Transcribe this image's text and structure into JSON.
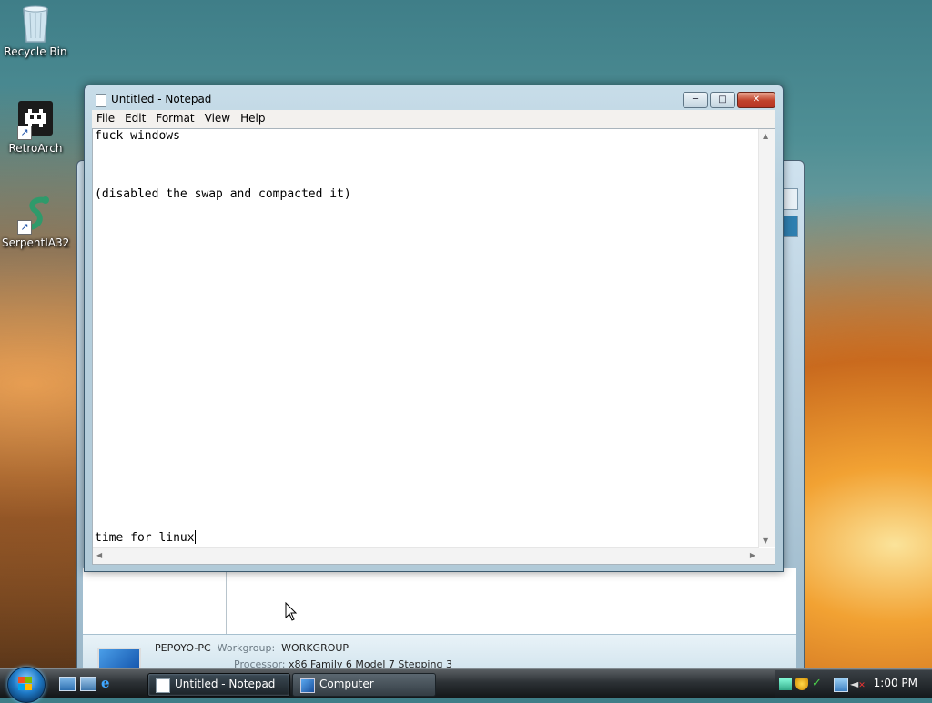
{
  "desktop": {
    "icons": [
      {
        "label": "Recycle Bin",
        "icon": "recycle-bin-icon"
      },
      {
        "label": "RetroArch",
        "icon": "retroarch-icon"
      },
      {
        "label": "SerpentIA32",
        "icon": "serpent-icon"
      }
    ]
  },
  "notepad": {
    "title": "Untitled - Notepad",
    "menu": [
      "File",
      "Edit",
      "Format",
      "View",
      "Help"
    ],
    "lines": [
      {
        "text": "fuck windows"
      },
      {
        "text": ""
      },
      {
        "text": ""
      },
      {
        "text": "(disabled the swap and compacted it)"
      },
      {
        "text": "time for linux"
      }
    ]
  },
  "computer_window": {
    "computer_name": "PEPOYO-PC",
    "workgroup_label": "Workgroup:",
    "workgroup": "WORKGROUP",
    "processor_label": "Processor:",
    "processor": "x86 Family 6 Model 7 Stepping 3"
  },
  "taskbar": {
    "tasks": [
      {
        "label": "Untitled - Notepad",
        "icon": "notepad-icon",
        "active": true
      },
      {
        "label": "Computer",
        "icon": "computer-icon",
        "active": false
      }
    ],
    "clock": "1:00 PM"
  },
  "colors": {
    "taskbar": "#2c3135",
    "close_button": "#c0412a",
    "titlebar": "#c8dde9"
  }
}
